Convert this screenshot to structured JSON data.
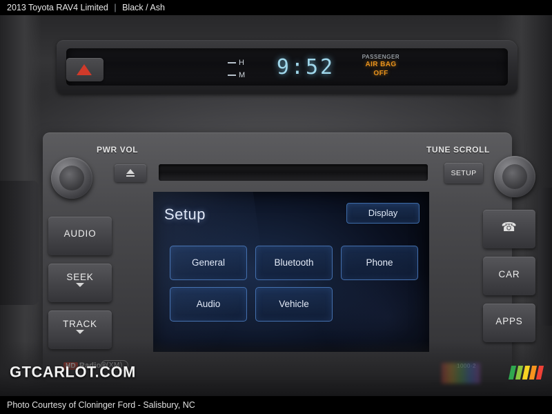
{
  "header": {
    "year_make_model": "2013 Toyota RAV4 Limited",
    "separator": "|",
    "colors": "Black / Ash"
  },
  "footer": {
    "caption": "Photo Courtesy of Cloninger Ford - Salisbury, NC"
  },
  "watermark": {
    "text": "GTCARLOT.COM"
  },
  "instrument_display": {
    "clock": "9:52",
    "temp_marks": {
      "high": "H",
      "mid": "M"
    },
    "passenger_label": "PASSENGER",
    "airbag_line1": "AIR BAG",
    "airbag_line2": "OFF"
  },
  "head_unit": {
    "label_left_knob": "PWR VOL",
    "label_right_knob": "TUNE SCROLL",
    "setup_button": "SETUP",
    "left_buttons": [
      {
        "label": "AUDIO",
        "chevron": "none"
      },
      {
        "label": "SEEK",
        "chevron": "down"
      },
      {
        "label": "TRACK",
        "chevron": "down"
      }
    ],
    "right_buttons": [
      {
        "label": "",
        "icon": "phone-icon"
      },
      {
        "label": "CAR",
        "icon": ""
      },
      {
        "label": "APPS",
        "icon": ""
      }
    ],
    "badges": {
      "hd_prefix": "HD",
      "hd_text": "Radio",
      "hd_sup": "®",
      "xm": "(XM)",
      "model_code": "1000·2"
    }
  },
  "touchscreen": {
    "title": "Setup",
    "display_button": "Display",
    "tiles": [
      "General",
      "Bluetooth",
      "Phone",
      "Audio",
      "Vehicle"
    ],
    "accent_color": "#4470ae",
    "text_color": "#e4ebf7"
  }
}
